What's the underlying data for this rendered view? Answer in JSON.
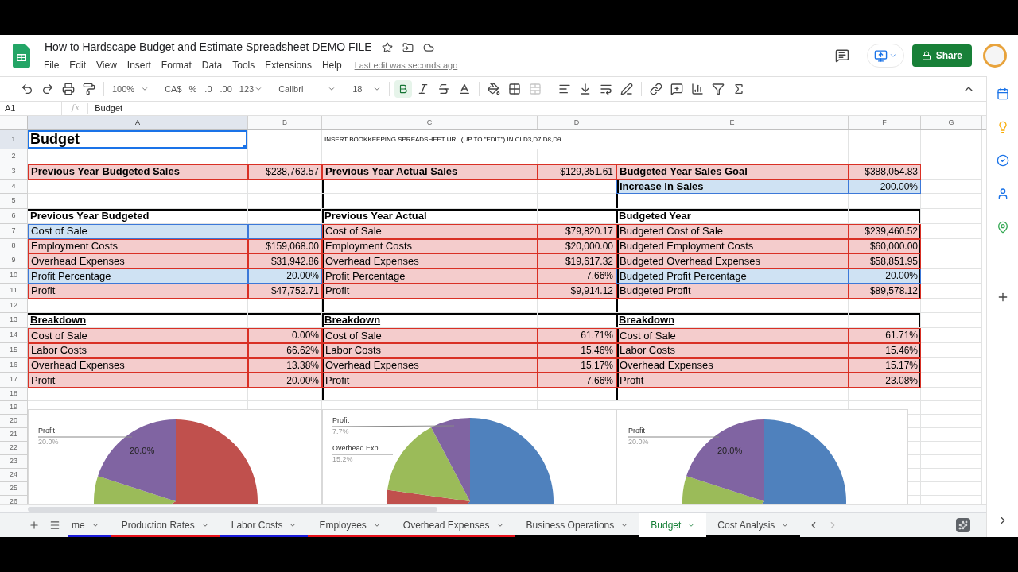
{
  "document": {
    "title": "How to Hardscape Budget and Estimate Spreadsheet DEMO FILE",
    "last_edit": "Last edit was seconds ago"
  },
  "menu": [
    "File",
    "Edit",
    "View",
    "Insert",
    "Format",
    "Data",
    "Tools",
    "Extensions",
    "Help"
  ],
  "share_button": "Share",
  "toolbar": {
    "zoom": "100%",
    "currency": "CA$",
    "percent": "%",
    "decrease_decimals": ".0",
    "increase_decimals": ".00",
    "number_format": "123",
    "font": "Calibri",
    "font_size": "18",
    "bold_on": true
  },
  "formula_bar": {
    "cell": "A1",
    "fx": "fx",
    "content": "Budget"
  },
  "columns": [
    "A",
    "B",
    "C",
    "D",
    "E",
    "F",
    "G"
  ],
  "rows": [
    {
      "number": "1",
      "cells": [
        {
          "text": "Budget",
          "kind": "title",
          "selected": true
        },
        {},
        {
          "text": "INSERT BOOKKEEPING SPREADSHEET URL (UP TO \"EDIT\") IN CI D3,D7,D8,D9",
          "kind": "note",
          "selected": false
        }
      ]
    },
    {
      "number": "2"
    },
    {
      "number": "3",
      "cells": [
        {
          "text": "Previous Year Budgeted Sales",
          "kind": "strong",
          "color": "#f4cccc",
          "selected": false
        },
        {
          "text": "$238,763.57",
          "kind": "value",
          "color": "#f4cccc",
          "selected": false
        },
        {
          "text": "Previous Year Actual Sales",
          "kind": "strong",
          "color": "#f4cccc",
          "selected": false
        },
        {
          "text": "$129,351.61",
          "kind": "value",
          "color": "#f4cccc",
          "selected": false
        },
        {
          "text": "Budgeted Year Sales Goal",
          "kind": "strong",
          "color": "#f4cccc",
          "selected": false
        },
        {
          "text": "$388,054.83",
          "kind": "value",
          "color": "#f4cccc",
          "selected": false
        }
      ]
    },
    {
      "number": "4",
      "cells": [
        {},
        {},
        {},
        {},
        {
          "text": "Increase in Sales",
          "kind": "strong",
          "color": "#cfe2f3",
          "selected": false
        },
        {
          "text": "200.00%",
          "kind": "value",
          "color": "#cfe2f3",
          "selected": false
        }
      ]
    },
    {
      "number": "5"
    },
    {
      "number": "6",
      "cells": [
        {
          "text": "Previous Year Budgeted",
          "kind": "strong",
          "selected": false
        },
        {},
        {
          "text": "Previous Year Actual",
          "kind": "strong",
          "selected": false
        },
        {},
        {
          "text": "Budgeted Year",
          "kind": "strong",
          "selected": false
        }
      ]
    },
    {
      "number": "7",
      "cells": [
        {
          "text": "Cost of Sale",
          "kind": "label",
          "color": "#cfe2f3",
          "selected": false
        },
        {
          "kind": "value",
          "color": "#cfe2f3",
          "selected": false
        },
        {
          "text": "Cost of Sale",
          "kind": "label",
          "color": "#f4cccc",
          "selected": false
        },
        {
          "text": "$79,820.17",
          "kind": "value",
          "color": "#f4cccc",
          "selected": false
        },
        {
          "text": "Budgeted Cost of Sale",
          "kind": "label",
          "color": "#f4cccc",
          "selected": false
        },
        {
          "text": "$239,460.52",
          "kind": "value",
          "color": "#f4cccc",
          "selected": false
        }
      ]
    },
    {
      "number": "8",
      "cells": [
        {
          "text": "Employment Costs",
          "kind": "label",
          "color": "#f4cccc",
          "selected": false
        },
        {
          "text": "$159,068.00",
          "kind": "value",
          "color": "#f4cccc",
          "selected": false
        },
        {
          "text": "Employment Costs",
          "kind": "label",
          "color": "#f4cccc",
          "selected": false
        },
        {
          "text": "$20,000.00",
          "kind": "value",
          "color": "#f4cccc",
          "selected": false
        },
        {
          "text": "Budgeted Employment Costs",
          "kind": "label",
          "color": "#f4cccc",
          "selected": false
        },
        {
          "text": "$60,000.00",
          "kind": "value",
          "color": "#f4cccc",
          "selected": false
        }
      ]
    },
    {
      "number": "9",
      "cells": [
        {
          "text": "Overhead Expenses",
          "kind": "label",
          "color": "#f4cccc",
          "selected": false
        },
        {
          "text": "$31,942.86",
          "kind": "value",
          "color": "#f4cccc",
          "selected": false
        },
        {
          "text": "Overhead Expenses",
          "kind": "label",
          "color": "#f4cccc",
          "selected": false
        },
        {
          "text": "$19,617.32",
          "kind": "value",
          "color": "#f4cccc",
          "selected": false
        },
        {
          "text": "Budgeted Overhead Expenses",
          "kind": "label",
          "color": "#f4cccc",
          "selected": false
        },
        {
          "text": "$58,851.95",
          "kind": "value",
          "color": "#f4cccc",
          "selected": false
        }
      ]
    },
    {
      "number": "10",
      "cells": [
        {
          "text": "Profit Percentage",
          "kind": "label",
          "color": "#cfe2f3",
          "selected": false
        },
        {
          "text": "20.00%",
          "kind": "value",
          "color": "#cfe2f3",
          "selected": false
        },
        {
          "text": "Profit Percentage",
          "kind": "label",
          "color": "#f4cccc",
          "selected": false
        },
        {
          "text": "7.66%",
          "kind": "value",
          "color": "#f4cccc",
          "selected": false
        },
        {
          "text": "Budgeted Profit Percentage",
          "kind": "label",
          "color": "#cfe2f3",
          "selected": false
        },
        {
          "text": "20.00%",
          "kind": "value",
          "color": "#cfe2f3",
          "selected": false
        }
      ]
    },
    {
      "number": "11",
      "cells": [
        {
          "text": "Profit",
          "kind": "label",
          "color": "#f4cccc",
          "selected": false
        },
        {
          "text": "$47,752.71",
          "kind": "value",
          "color": "#f4cccc",
          "selected": false
        },
        {
          "text": "Profit",
          "kind": "label",
          "color": "#f4cccc",
          "selected": false
        },
        {
          "text": "$9,914.12",
          "kind": "value",
          "color": "#f4cccc",
          "selected": false
        },
        {
          "text": "Budgeted Profit",
          "kind": "label",
          "color": "#f4cccc",
          "selected": false
        },
        {
          "text": "$89,578.12",
          "kind": "value",
          "color": "#f4cccc",
          "selected": false
        }
      ]
    },
    {
      "number": "12"
    },
    {
      "number": "13",
      "cells": [
        {
          "text": "Breakdown",
          "kind": "heading",
          "selected": false
        },
        {},
        {
          "text": "Breakdown",
          "kind": "heading",
          "selected": false
        },
        {},
        {
          "text": "Breakdown",
          "kind": "heading",
          "selected": false
        }
      ]
    },
    {
      "number": "14",
      "cells": [
        {
          "text": "Cost of Sale",
          "kind": "label",
          "color": "#f4cccc",
          "selected": false
        },
        {
          "text": "0.00%",
          "kind": "value",
          "color": "#f4cccc",
          "selected": false
        },
        {
          "text": "Cost of Sale",
          "kind": "label",
          "color": "#f4cccc",
          "selected": false
        },
        {
          "text": "61.71%",
          "kind": "value",
          "color": "#f4cccc",
          "selected": false
        },
        {
          "text": "Cost of Sale",
          "kind": "label",
          "color": "#f4cccc",
          "selected": false
        },
        {
          "text": "61.71%",
          "kind": "value",
          "color": "#f4cccc",
          "selected": false
        }
      ]
    },
    {
      "number": "15",
      "cells": [
        {
          "text": "Labor Costs",
          "kind": "label",
          "color": "#f4cccc",
          "selected": false
        },
        {
          "text": "66.62%",
          "kind": "value",
          "color": "#f4cccc",
          "selected": false
        },
        {
          "text": "Labor Costs",
          "kind": "label",
          "color": "#f4cccc",
          "selected": false
        },
        {
          "text": "15.46%",
          "kind": "value",
          "color": "#f4cccc",
          "selected": false
        },
        {
          "text": "Labor Costs",
          "kind": "label",
          "color": "#f4cccc",
          "selected": false
        },
        {
          "text": "15.46%",
          "kind": "value",
          "color": "#f4cccc",
          "selected": false
        }
      ]
    },
    {
      "number": "16",
      "cells": [
        {
          "text": "Overhead Expenses",
          "kind": "label",
          "color": "#f4cccc",
          "selected": false
        },
        {
          "text": "13.38%",
          "kind": "value",
          "color": "#f4cccc",
          "selected": false
        },
        {
          "text": "Overhead Expenses",
          "kind": "label",
          "color": "#f4cccc",
          "selected": false
        },
        {
          "text": "15.17%",
          "kind": "value",
          "color": "#f4cccc",
          "selected": false
        },
        {
          "text": "Overhead Expenses",
          "kind": "label",
          "color": "#f4cccc",
          "selected": false
        },
        {
          "text": "15.17%",
          "kind": "value",
          "color": "#f4cccc",
          "selected": false
        }
      ]
    },
    {
      "number": "17",
      "cells": [
        {
          "text": "Profit",
          "kind": "label",
          "color": "#f4cccc",
          "selected": false
        },
        {
          "text": "20.00%",
          "kind": "value",
          "color": "#f4cccc",
          "selected": false
        },
        {
          "text": "Profit",
          "kind": "label",
          "color": "#f4cccc",
          "selected": false
        },
        {
          "text": "7.66%",
          "kind": "value",
          "color": "#f4cccc",
          "selected": false
        },
        {
          "text": "Profit",
          "kind": "label",
          "color": "#f4cccc",
          "selected": false
        },
        {
          "text": "23.08%",
          "kind": "value",
          "color": "#f4cccc",
          "selected": false
        }
      ]
    },
    {
      "number": "18"
    },
    {
      "number": "19"
    },
    {
      "number": "20"
    },
    {
      "number": "21"
    },
    {
      "number": "22"
    },
    {
      "number": "23"
    },
    {
      "number": "24"
    },
    {
      "number": "25"
    },
    {
      "number": "26"
    }
  ],
  "charts": [
    {
      "labels": [
        {
          "text": "Profit",
          "kind": "name"
        },
        {
          "text": "20.0%",
          "kind": "share"
        },
        {
          "text": "20.0%",
          "kind": "inside"
        }
      ]
    },
    {
      "labels": [
        {
          "text": "Profit",
          "kind": "name"
        },
        {
          "text": "7.7%",
          "kind": "share"
        },
        {
          "text": "Overhead Exp...",
          "kind": "name"
        },
        {
          "text": "15.2%",
          "kind": "share"
        }
      ]
    },
    {
      "labels": [
        {
          "text": "Profit",
          "kind": "name"
        },
        {
          "text": "20.0%",
          "kind": "share"
        },
        {
          "text": "20.0%",
          "kind": "inside"
        }
      ]
    }
  ],
  "sheet_tabs": [
    {
      "label": "me",
      "selected": false,
      "color": "#1a1adb"
    },
    {
      "label": "Production Rates",
      "selected": false,
      "color": "#e8111b"
    },
    {
      "label": "Labor Costs",
      "selected": false,
      "color": "#1a1adb"
    },
    {
      "label": "Employees",
      "selected": false,
      "color": "#e8111b"
    },
    {
      "label": "Overhead Expenses",
      "selected": false,
      "color": "#e8111b"
    },
    {
      "label": "Business Operations",
      "selected": false,
      "color": "#000000"
    },
    {
      "label": "Budget",
      "selected": true
    },
    {
      "label": "Cost Analysis",
      "selected": false,
      "color": "#000000"
    }
  ]
}
